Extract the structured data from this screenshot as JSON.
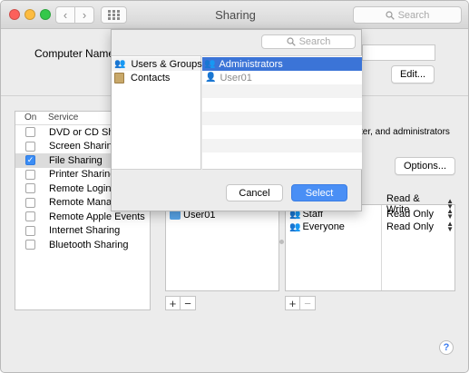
{
  "window": {
    "title": "Sharing",
    "search_placeholder": "Search"
  },
  "toolbar": {
    "back_icon": "chevron-left-icon",
    "forward_icon": "chevron-right-icon",
    "grid_icon": "grid-icon"
  },
  "computer_name": {
    "label": "Computer Name:",
    "edit_label": "Edit..."
  },
  "services": {
    "header_on": "On",
    "header_service": "Service",
    "items": [
      {
        "label": "DVD or CD Shari",
        "checked": false
      },
      {
        "label": "Screen Sharing",
        "checked": false
      },
      {
        "label": "File Sharing",
        "checked": true
      },
      {
        "label": "Printer Sharing",
        "checked": false
      },
      {
        "label": "Remote Login",
        "checked": false
      },
      {
        "label": "Remote Manage",
        "checked": false
      },
      {
        "label": "Remote Apple Events",
        "checked": false
      },
      {
        "label": "Internet Sharing",
        "checked": false
      },
      {
        "label": "Bluetooth Sharing",
        "checked": false
      }
    ]
  },
  "description": {
    "text": "ter, and administrators",
    "options_label": "Options..."
  },
  "shared_folders": {
    "items": [
      "User01"
    ]
  },
  "users": {
    "items": [
      {
        "name": "Staff",
        "permission": "Read Only"
      },
      {
        "name": "Everyone",
        "permission": "Read Only"
      }
    ],
    "first_permission": "Read & Write"
  },
  "controls": {
    "add": "+",
    "remove": "−",
    "help": "?"
  },
  "dialog": {
    "search_placeholder": "Search",
    "sources": [
      {
        "label": "Users & Groups",
        "selected": true
      },
      {
        "label": "Contacts",
        "selected": false
      }
    ],
    "entries": [
      {
        "label": "Administrators",
        "selected": true
      },
      {
        "label": "User01",
        "selected": false
      }
    ],
    "cancel_label": "Cancel",
    "select_label": "Select"
  },
  "colors": {
    "accent": "#3b74d7",
    "select_button": "#4a8ff5",
    "checkbox_on": "#3b8df5"
  }
}
